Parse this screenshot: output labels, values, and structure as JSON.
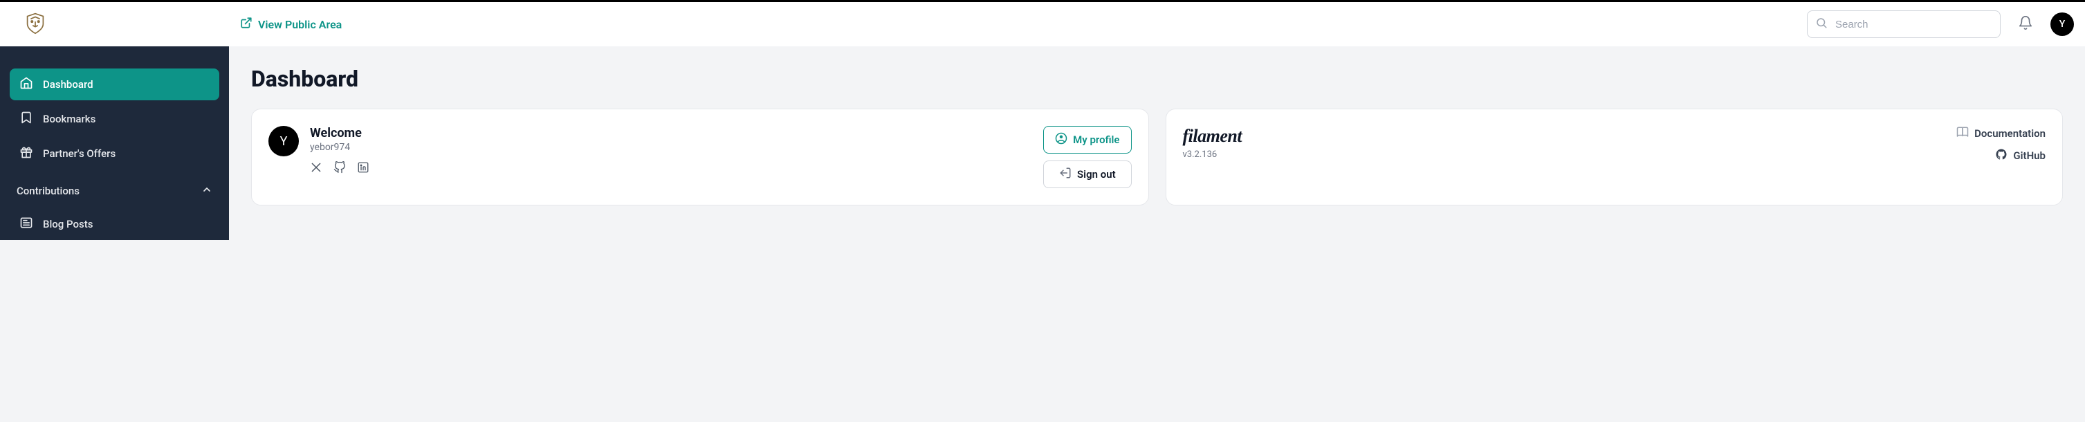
{
  "header": {
    "view_public": "View Public Area",
    "search_placeholder": "Search",
    "avatar_letter": "Y"
  },
  "sidebar": {
    "items": [
      {
        "label": "Dashboard",
        "icon": "home-icon",
        "active": true
      },
      {
        "label": "Bookmarks",
        "icon": "bookmark-icon",
        "active": false
      },
      {
        "label": "Partner's Offers",
        "icon": "gift-icon",
        "active": false
      }
    ],
    "group": {
      "label": "Contributions"
    },
    "sub_items": [
      {
        "label": "Blog Posts",
        "icon": "newspaper-icon"
      }
    ]
  },
  "page": {
    "title": "Dashboard"
  },
  "welcome": {
    "title": "Welcome",
    "username": "yebor974",
    "avatar_letter": "Y",
    "profile_btn": "My profile",
    "signout_btn": "Sign out"
  },
  "filament": {
    "name": "filament",
    "version": "v3.2.136",
    "doc_label": "Documentation",
    "github_label": "GitHub"
  }
}
